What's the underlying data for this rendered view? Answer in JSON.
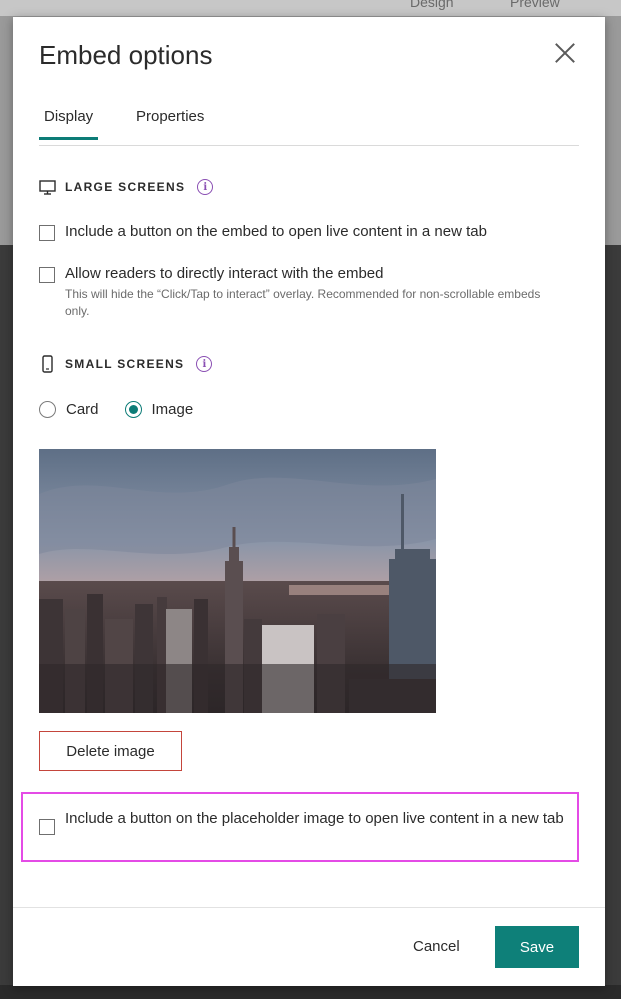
{
  "background": {
    "tab_design": "Design",
    "tab_preview": "Preview"
  },
  "dialog": {
    "title": "Embed options",
    "tabs": [
      {
        "label": "Display",
        "active": true
      },
      {
        "label": "Properties",
        "active": false
      }
    ],
    "large_screens": {
      "heading": "LARGE SCREENS",
      "icon": "monitor-icon",
      "options": [
        {
          "label": "Include a button on the embed to open live content in a new tab",
          "checked": false
        },
        {
          "label": "Allow readers to directly interact with the embed",
          "helper": "This will hide the “Click/Tap to interact” overlay. Recommended for non-scrollable embeds only.",
          "checked": false
        }
      ]
    },
    "small_screens": {
      "heading": "SMALL SCREENS",
      "icon": "phone-icon",
      "radios": [
        {
          "label": "Card",
          "selected": false
        },
        {
          "label": "Image",
          "selected": true
        }
      ],
      "delete_image_label": "Delete image",
      "placeholder_option": {
        "label": "Include a button on the placeholder image to open live content in a new tab",
        "checked": false
      }
    },
    "footer": {
      "cancel_label": "Cancel",
      "save_label": "Save"
    }
  },
  "colors": {
    "accent": "#0e8079",
    "danger_border": "#c4453b",
    "highlight": "#e44be6",
    "info_icon": "#8a4fb3"
  }
}
